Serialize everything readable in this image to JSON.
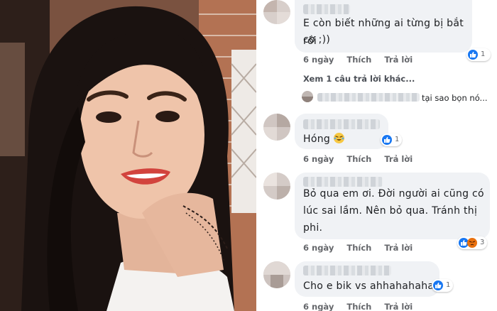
{
  "comments": [
    {
      "text_lines": [
        "E còn biết những ai từng bị bắt rồi",
        "cơ ;))"
      ],
      "time": "6 ngày",
      "like_label": "Thích",
      "reply_label": "Trả lời",
      "reactions": {
        "types": [
          "like"
        ],
        "count": "1"
      }
    },
    {
      "text_lines": [
        "Hóng"
      ],
      "emoji": "face-with-tears-of-joy",
      "time": "6 ngày",
      "like_label": "Thích",
      "reply_label": "Trả lời",
      "reactions": {
        "types": [
          "like"
        ],
        "count": "1"
      }
    },
    {
      "text_lines": [
        "Bỏ qua em ơi. Đời người ai cũng có",
        "lúc sai lầm. Nên bỏ qua. Tránh thị",
        "phi."
      ],
      "time": "6 ngày",
      "like_label": "Thích",
      "reply_label": "Trả lời",
      "reactions": {
        "types": [
          "like",
          "angry"
        ],
        "count": "3"
      }
    },
    {
      "text_lines": [
        "Cho e bik vs ahhahahaha"
      ],
      "time": "6 ngày",
      "like_label": "Thích",
      "reply_label": "Trả lời",
      "reactions": {
        "types": [
          "like"
        ],
        "count": "1"
      }
    }
  ],
  "more_replies": {
    "label": "Xem 1 câu trả lời khác...",
    "preview_text": "tại sao bọn nó..."
  },
  "colors": {
    "bubble": "#f0f2f5",
    "meta_text": "#65676b",
    "like_blue": "#1877f2",
    "angry_orange": "#e9710f"
  }
}
